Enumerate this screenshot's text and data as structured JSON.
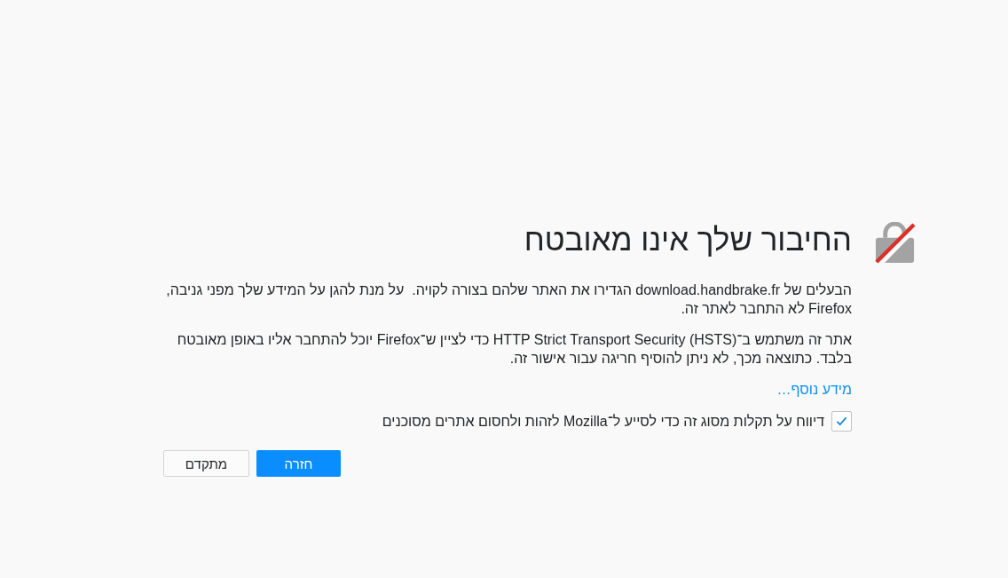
{
  "title": "החיבור שלך אינו מאובטח",
  "paragraphs": [
    "הבעלים של download.handbrake.fr הגדירו את האתר שלהם בצורה לקויה.  על מנת להגן על המידע שלך מפני גניבה, Firefox לא התחבר לאתר זה.",
    "אתר זה משתמש ב־HTTP Strict Transport Security (HSTS) כדי לציין ש־Firefox יוכל להתחבר אליו באופן מאובטח בלבד. כתוצאה מכך, לא ניתן להוסיף חריגה עבור אישור זה."
  ],
  "learn_more_link": "מידע נוסף…",
  "report_checkbox": {
    "label": "דיווח על תקלות מסוג זה כדי לסייע ל־Mozilla לזהות ולחסום אתרים מסוכנים",
    "checked": true
  },
  "buttons": [
    {
      "label": "חזרה",
      "kind": "primary"
    },
    {
      "label": "מתקדם",
      "kind": "secondary"
    }
  ]
}
